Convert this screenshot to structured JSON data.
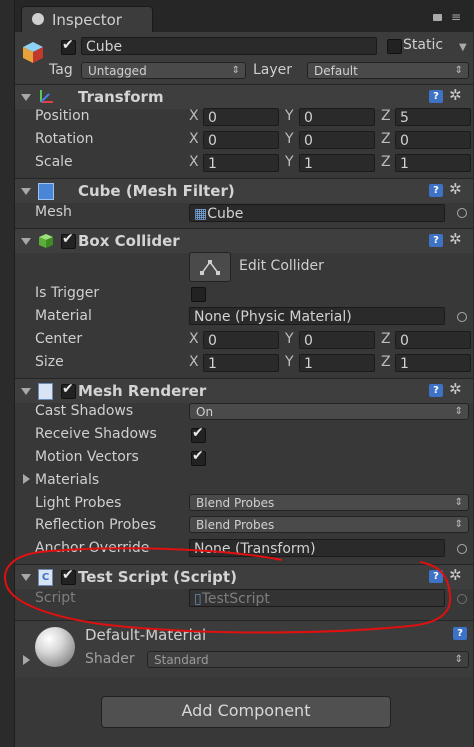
{
  "tab": {
    "title": "Inspector"
  },
  "object": {
    "name": "Cube",
    "static_label": "Static",
    "tag_label": "Tag",
    "tag_value": "Untagged",
    "layer_label": "Layer",
    "layer_value": "Default"
  },
  "transform": {
    "title": "Transform",
    "rows": [
      {
        "label": "Position",
        "x": "0",
        "y": "0",
        "z": "5"
      },
      {
        "label": "Rotation",
        "x": "0",
        "y": "0",
        "z": "0"
      },
      {
        "label": "Scale",
        "x": "1",
        "y": "1",
        "z": "1"
      }
    ]
  },
  "axes": {
    "x": "X",
    "y": "Y",
    "z": "Z"
  },
  "mesh_filter": {
    "title": "Cube (Mesh Filter)",
    "mesh_label": "Mesh",
    "mesh_value": "Cube"
  },
  "box_collider": {
    "title": "Box Collider",
    "edit_label": "Edit Collider",
    "is_trigger_label": "Is Trigger",
    "material_label": "Material",
    "material_value": "None (Physic Material)",
    "center": {
      "label": "Center",
      "x": "0",
      "y": "0",
      "z": "0"
    },
    "size": {
      "label": "Size",
      "x": "1",
      "y": "1",
      "z": "1"
    }
  },
  "mesh_renderer": {
    "title": "Mesh Renderer",
    "cast_shadows_label": "Cast Shadows",
    "cast_shadows_value": "On",
    "receive_shadows_label": "Receive Shadows",
    "motion_vectors_label": "Motion Vectors",
    "materials_label": "Materials",
    "light_probes_label": "Light Probes",
    "light_probes_value": "Blend Probes",
    "reflection_probes_label": "Reflection Probes",
    "reflection_probes_value": "Blend Probes",
    "anchor_label": "Anchor Override",
    "anchor_value": "None (Transform)"
  },
  "test_script": {
    "title": "Test Script (Script)",
    "script_label": "Script",
    "script_value": "TestScript"
  },
  "material": {
    "name": "Default-Material",
    "shader_label": "Shader",
    "shader_value": "Standard"
  },
  "add_component": {
    "label": "Add Component"
  },
  "colors": {
    "annotation": "#e01010",
    "help_blue": "#3d72c6"
  }
}
